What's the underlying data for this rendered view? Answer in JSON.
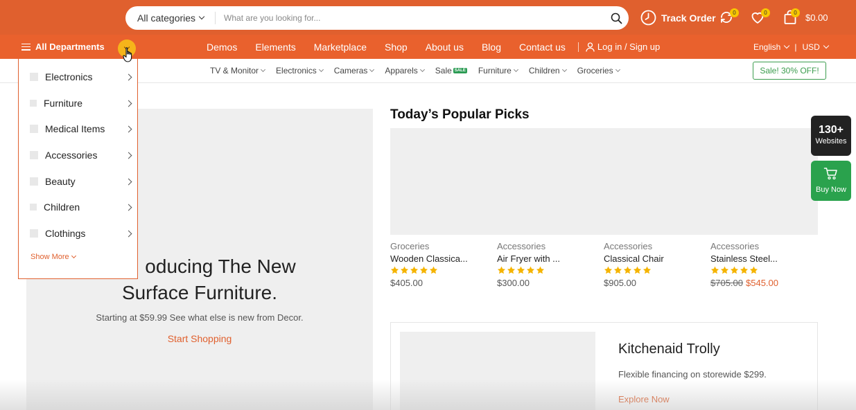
{
  "header": {
    "search": {
      "category": "All categories",
      "placeholder": "What are you looking for..."
    },
    "track_order": "Track Order",
    "compare_count": "0",
    "wishlist_count": "0",
    "cart_count": "0",
    "cart_total": "$0.00"
  },
  "nav": {
    "all_departments": "All Departments",
    "links": [
      "Demos",
      "Elements",
      "Marketplace",
      "Shop",
      "About us",
      "Blog",
      "Contact us"
    ],
    "login": "Log in / Sign up",
    "language": "English",
    "currency": "USD"
  },
  "subnav": {
    "items": [
      "TV & Monitor",
      "Electronics",
      "Cameras",
      "Apparels",
      "Sale",
      "Furniture",
      "Children",
      "Groceries"
    ],
    "sale_badge": "SALE",
    "promo": "Sale! 30% OFF!"
  },
  "departments": {
    "items": [
      "Electronics",
      "Furniture",
      "Medical Items",
      "Accessories",
      "Beauty",
      "Children",
      "Clothings"
    ],
    "show_more": "Show More"
  },
  "hero": {
    "title_line1": "oducing The New",
    "title_line2": "Surface Furniture.",
    "subtitle": "Starting at $59.99 See what else is new from Decor.",
    "link": "Start Shopping"
  },
  "popular": {
    "title": "Today’s Popular Picks",
    "products": [
      {
        "category": "Groceries",
        "name": "Wooden Classica...",
        "price": "$405.00",
        "rating": 5
      },
      {
        "category": "Accessories",
        "name": "Air Fryer with ...",
        "price": "$300.00",
        "rating": 5
      },
      {
        "category": "Accessories",
        "name": "Classical Chair",
        "price": "$905.00",
        "rating": 5
      },
      {
        "category": "Accessories",
        "name": "Stainless Steel...",
        "old_price": "$705.00",
        "price": "$545.00",
        "rating": 5
      }
    ]
  },
  "promo": {
    "title": "Kitchenaid Trolly",
    "subtitle": "Flexible financing on storewide $299.",
    "link": "Explore Now"
  },
  "side": {
    "websites_count": "130+",
    "websites_label": "Websites",
    "buy_label": "Buy Now"
  },
  "colors": {
    "brand": "#e9612d",
    "accent_yellow": "#f7c600",
    "green": "#2aa24d"
  }
}
